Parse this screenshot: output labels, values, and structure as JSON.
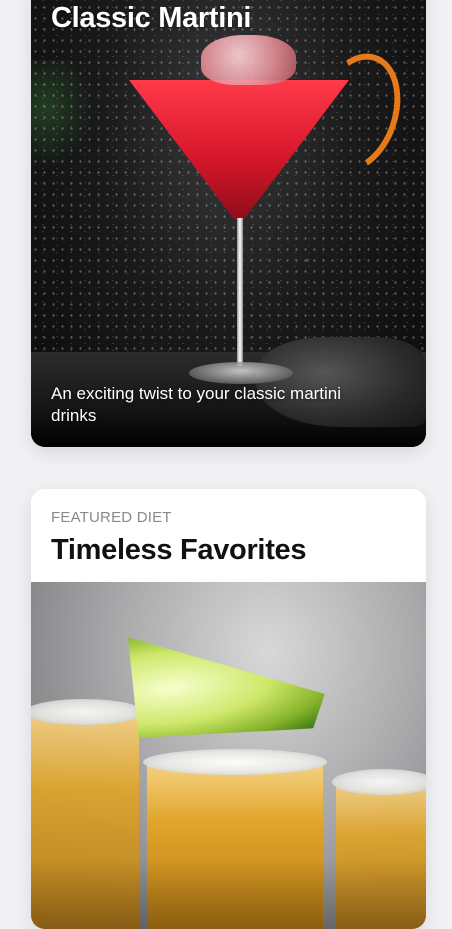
{
  "cards": [
    {
      "title": "Classic Martini",
      "description": "An exciting twist to your classic martini drinks",
      "image_alt": "Red martini cocktail with orange peel"
    },
    {
      "eyebrow": "FEATURED DIET",
      "title": "Timeless Favorites",
      "image_alt": "Tequila shots with salt rims and lime"
    }
  ]
}
